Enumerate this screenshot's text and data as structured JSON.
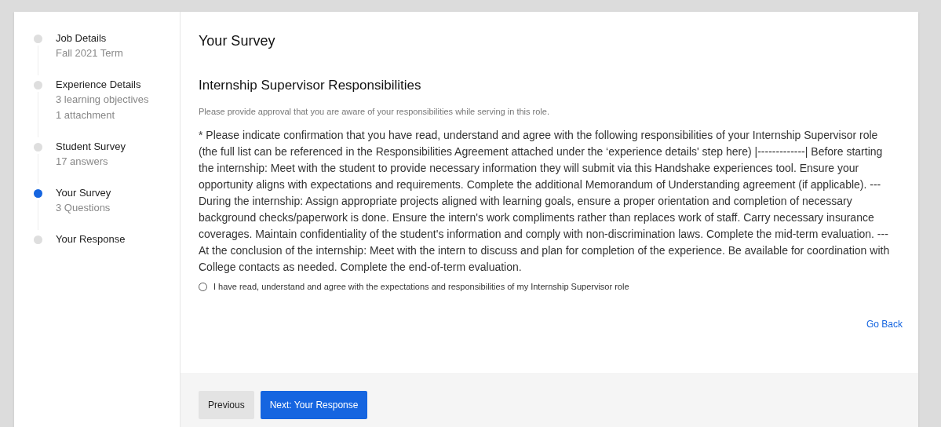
{
  "steps": [
    {
      "title": "Job Details",
      "details": [
        "Fall 2021 Term"
      ],
      "selected": false
    },
    {
      "title": "Experience Details",
      "details": [
        "3 learning objectives",
        "1 attachment"
      ],
      "selected": false
    },
    {
      "title": "Student Survey",
      "details": [
        "17 answers"
      ],
      "selected": false
    },
    {
      "title": "Your Survey",
      "details": [
        "3 Questions"
      ],
      "selected": true
    },
    {
      "title": "Your Response",
      "selected": false
    }
  ],
  "page_title": "Your Survey",
  "section": {
    "title": "Internship Supervisor Responsibilities",
    "description": "Please provide approval that you are aware of your responsibilities while serving in this role.",
    "question": "* Please indicate confirmation that you have read, understand and agree with the following responsibilities of your Internship Supervisor role (the full list can be referenced in the Responsibilities Agreement attached under the ‘experience details' step here) |-------------| Before starting the internship: Meet with the student to provide necessary information they will submit via this Handshake experiences tool. Ensure your opportunity aligns with expectations and requirements. Complete the additional Memorandum of Understanding agreement (if applicable). --- During the internship: Assign appropriate projects aligned with learning goals, ensure a proper orientation and completion of necessary background checks/paperwork is done. Ensure the intern's work compliments rather than replaces work of staff. Carry necessary insurance coverages. Maintain confidentiality of the student's information and comply with non-discrimination laws. Complete the mid-term evaluation. --- At the conclusion of the internship: Meet with the intern to discuss and plan for completion of the experience. Be available for coordination with College contacts as needed. Complete the end-of-term evaluation.",
    "option": {
      "label": "I have read, understand and agree with the expectations and responsibilities of my Internship Supervisor role",
      "selected": false
    }
  },
  "go_back": "Go Back",
  "footer": {
    "previous": "Previous",
    "next": "Next: Your Response"
  }
}
